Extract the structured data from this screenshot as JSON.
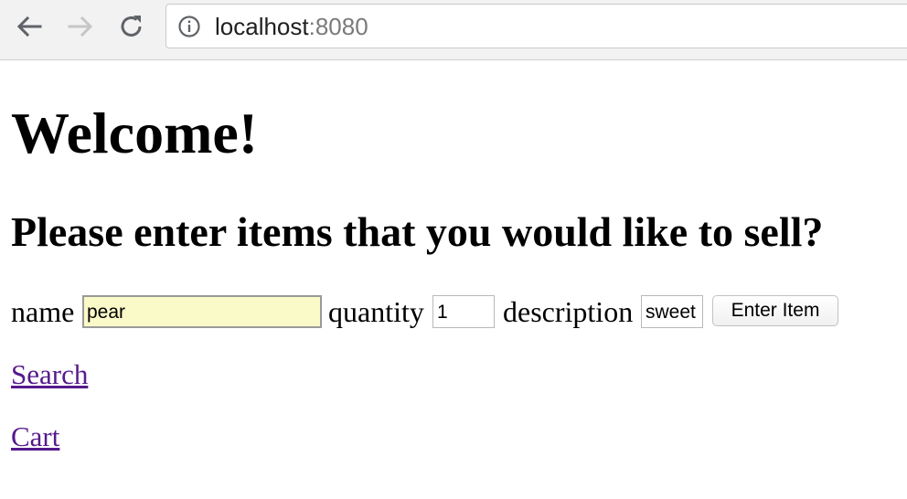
{
  "browser": {
    "url_host": "localhost",
    "url_port": ":8080",
    "icons": {
      "back": "arrow-left-icon",
      "forward": "arrow-right-icon",
      "reload": "reload-icon",
      "info": "info-icon"
    }
  },
  "page": {
    "title": "Welcome!",
    "subtitle": "Please enter items that you would like to sell?"
  },
  "form": {
    "name_label": "name",
    "name_value": "pear",
    "quantity_label": "quantity",
    "quantity_value": "1",
    "description_label": "description",
    "description_value": "sweet",
    "submit_label": "Enter Item"
  },
  "links": {
    "search": "Search",
    "cart": "Cart"
  },
  "colors": {
    "toolbar_bg": "#f2f2f2",
    "autofill_bg": "#fafac8",
    "visited_link": "#551a8b"
  }
}
